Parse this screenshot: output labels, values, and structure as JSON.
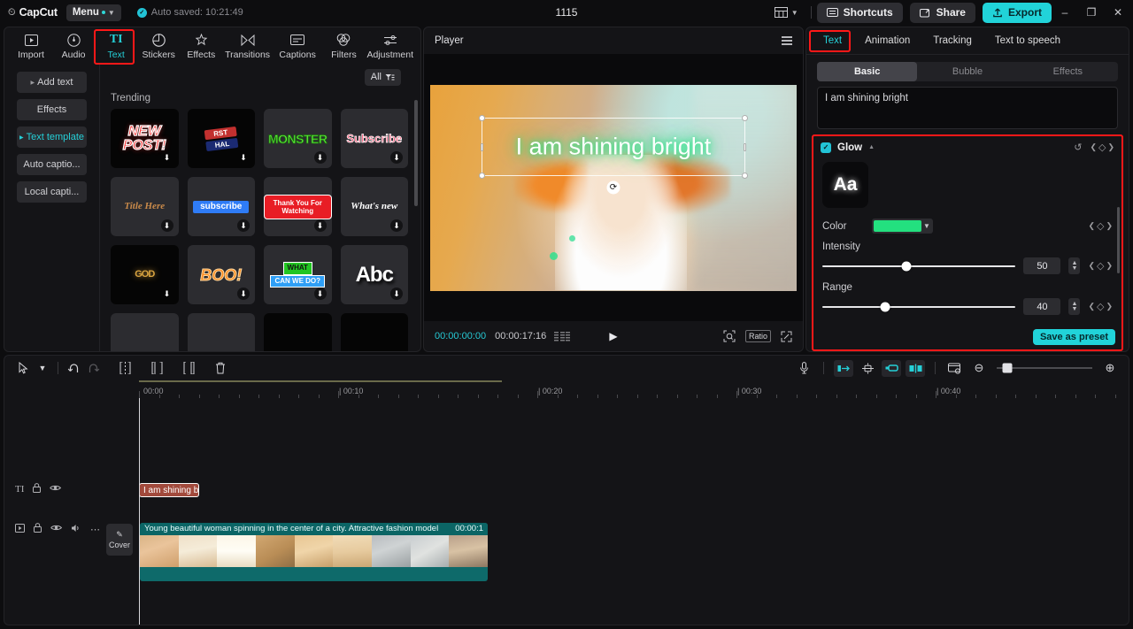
{
  "titlebar": {
    "brand": "CapCut",
    "menu_label": "Menu",
    "autosave": "Auto saved: 10:21:49",
    "project_title": "1115",
    "shortcuts": "Shortcuts",
    "share": "Share",
    "export": "Export",
    "minimize": "–",
    "maximize": "❐",
    "close": "✕",
    "layout_icon": "layout-icon",
    "check_icon": "✓"
  },
  "tool_tabs": [
    {
      "label": "Import",
      "icon": "▶",
      "active": false
    },
    {
      "label": "Audio",
      "icon": "♪",
      "active": false
    },
    {
      "label": "Text",
      "icon": "TI",
      "active": true
    },
    {
      "label": "Stickers",
      "icon": "◔",
      "active": false
    },
    {
      "label": "Effects",
      "icon": "✦",
      "active": false
    },
    {
      "label": "Transitions",
      "icon": "⋈",
      "active": false
    },
    {
      "label": "Captions",
      "icon": "▤",
      "active": false
    },
    {
      "label": "Filters",
      "icon": "◎",
      "active": false
    },
    {
      "label": "Adjustment",
      "icon": "≡",
      "active": false
    }
  ],
  "sub_nav": [
    {
      "label": "Add text",
      "arrow": true,
      "active": false
    },
    {
      "label": "Effects",
      "arrow": false,
      "active": false
    },
    {
      "label": "Text template",
      "arrow": true,
      "active": true
    },
    {
      "label": "Auto captio...",
      "arrow": false,
      "active": false
    },
    {
      "label": "Local capti...",
      "arrow": false,
      "active": false
    }
  ],
  "gallery": {
    "filter_label": "All",
    "filter_icon": "filter-icon",
    "section_title": "Trending",
    "templates": [
      {
        "name": "new-post",
        "text": "NEW\nPOST!"
      },
      {
        "name": "first-half",
        "text": "RST HAL"
      },
      {
        "name": "monster",
        "text": "MONSTER"
      },
      {
        "name": "subscribe-pink",
        "text": "Subscribe"
      },
      {
        "name": "title-here",
        "text": "Title Here"
      },
      {
        "name": "subscribe-blue",
        "text": "subscribe"
      },
      {
        "name": "thank-you-for-watching",
        "text": "Thank You For Watching"
      },
      {
        "name": "whats-new",
        "text": "What's new"
      },
      {
        "name": "god",
        "text": "GOD"
      },
      {
        "name": "boo",
        "text": "BOO!"
      },
      {
        "name": "what-can-we-do",
        "text": "WHAT CAN WE DO?"
      },
      {
        "name": "abc",
        "text": "Abc"
      }
    ]
  },
  "player": {
    "title": "Player",
    "overlay_text": "I am shining bright",
    "current_time": "00:00:00:00",
    "total_time": "00:00:17:16",
    "play_icon": "▶",
    "ratio_label": "Ratio",
    "glow_color": "#2ee88a"
  },
  "right_panel": {
    "tabs": [
      {
        "label": "Text",
        "active": true
      },
      {
        "label": "Animation",
        "active": false
      },
      {
        "label": "Tracking",
        "active": false
      },
      {
        "label": "Text to speech",
        "active": false
      }
    ],
    "segments": [
      {
        "label": "Basic",
        "active": true
      },
      {
        "label": "Bubble",
        "active": false
      },
      {
        "label": "Effects",
        "active": false
      }
    ],
    "text_value": "I am shining bright",
    "glow": {
      "enabled": true,
      "label": "Glow",
      "preview_glyph": "Aa",
      "color_label": "Color",
      "color_value": "#23e07f",
      "intensity_label": "Intensity",
      "intensity_value": "50",
      "range_label": "Range",
      "range_value": "40",
      "save_preset": "Save as preset",
      "reset_icon": "↺"
    }
  },
  "timeline": {
    "tools": [
      {
        "name": "select-tool",
        "glyph": "➤",
        "disabled": false
      },
      {
        "name": "tool-dropdown",
        "glyph": "⌄",
        "disabled": false
      },
      {
        "name": "undo",
        "glyph": "↶",
        "disabled": false
      },
      {
        "name": "redo",
        "glyph": "↷",
        "disabled": true
      },
      {
        "name": "split",
        "glyph": "⁅⁆",
        "disabled": false
      },
      {
        "name": "trim-left",
        "glyph": "⁅⁆",
        "disabled": false
      },
      {
        "name": "trim-right",
        "glyph": "⁅⁆",
        "disabled": false
      },
      {
        "name": "delete",
        "glyph": "Ὕ1",
        "disabled": false
      }
    ],
    "right_tools": [
      {
        "name": "mic-record-button",
        "glyph": "Ἲ4",
        "on": false
      },
      {
        "name": "auto-cut-button",
        "glyph": "■▶",
        "on": true
      },
      {
        "name": "adjust-speed-button",
        "glyph": "⚙",
        "on": false
      },
      {
        "name": "link-clips-button",
        "glyph": "⚭",
        "on": true
      },
      {
        "name": "mirror-button",
        "glyph": "◧◨",
        "on": true
      },
      {
        "name": "preview-button",
        "glyph": "❑",
        "on": false
      }
    ],
    "zoom_out_icon": "⊖",
    "zoom_in_icon": "⊕",
    "ruler_labels": [
      "00:00",
      "00:10",
      "00:20",
      "00:30",
      "00:40"
    ],
    "cover_label": "Cover",
    "text_clip_label": "I am shining b",
    "video_clip_label": "Young beautiful woman spinning in the center of a city. Attractive fashion model",
    "video_clip_duration": "00:00:1",
    "track_icons_text": [
      "TI",
      "ὑ2",
      "ὄ1"
    ],
    "track_icons_video": [
      "▣",
      "ὑ2",
      "ὄ1",
      "ὐA",
      "⋯"
    ]
  }
}
